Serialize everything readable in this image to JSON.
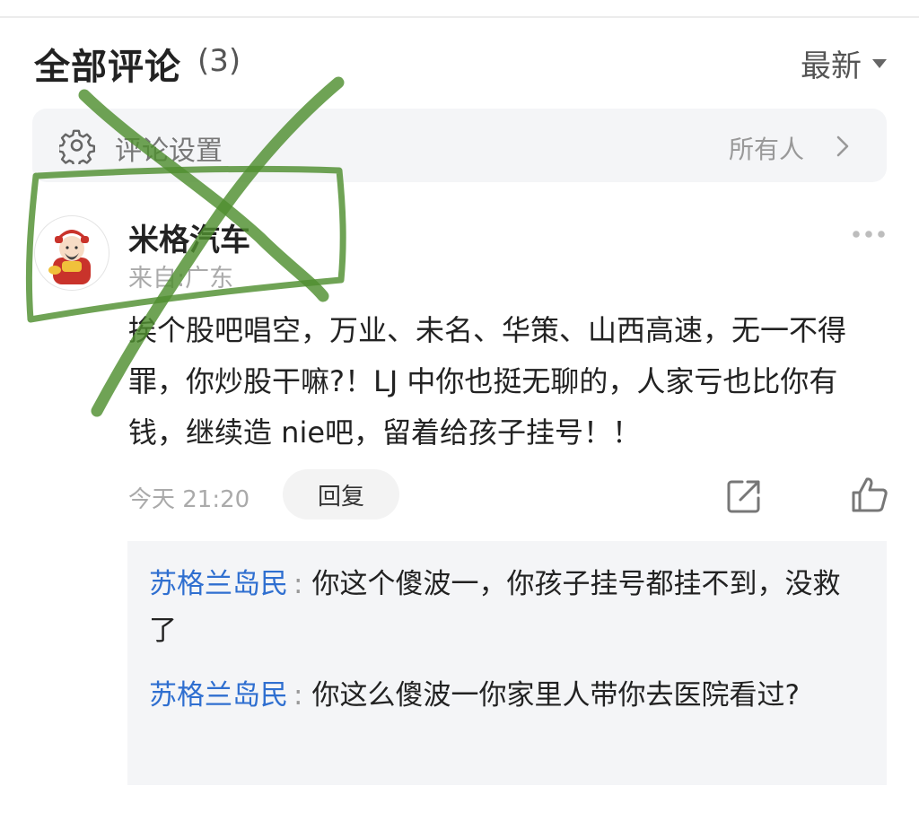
{
  "header": {
    "title": "全部评论",
    "count": "(3)",
    "sort_label": "最新"
  },
  "settings": {
    "label": "评论设置",
    "value": "所有人"
  },
  "comment": {
    "username": "米格汽车",
    "location": "来自:广东",
    "text": "挨个股吧唱空，万业、未名、华策、山西高速，无一不得罪，你炒股干嘛?！LJ 中你也挺无聊的，人家亏也比你有钱，继续造 nie吧，留着给孩子挂号！！",
    "time": "今天 21:20",
    "reply_label": "回复"
  },
  "replies": [
    {
      "author": "苏格兰岛民",
      "separator": ":",
      "text": "你这个傻波一，你孩子挂号都挂不到，没救了"
    },
    {
      "author": "苏格兰岛民",
      "separator": ":",
      "text": "你这么傻波一你家里人带你去医院看过?"
    }
  ],
  "colors": {
    "link": "#2f6fd0",
    "panel": "#f4f5f7",
    "annotation": "#4f8f2f"
  }
}
